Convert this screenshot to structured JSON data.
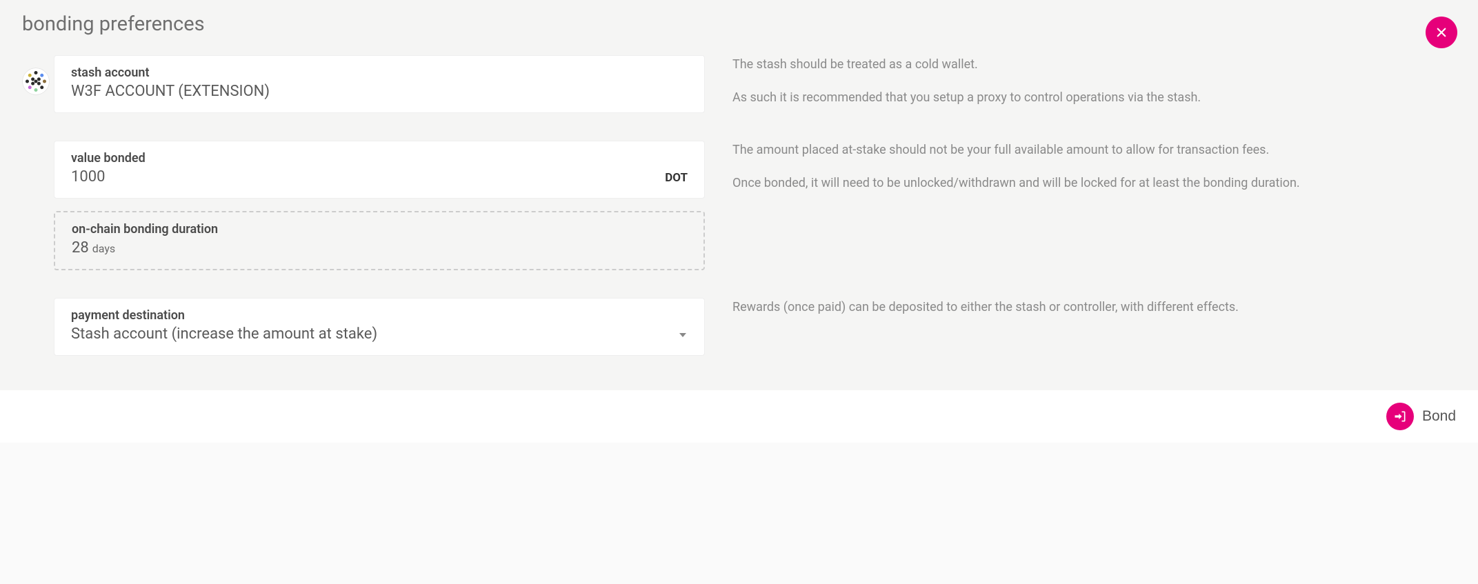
{
  "modal": {
    "title": "bonding preferences"
  },
  "stash": {
    "label": "stash account",
    "value": "W3F ACCOUNT (EXTENSION)",
    "help1": "The stash should be treated as a cold wallet.",
    "help2": "As such it is recommended that you setup a proxy to control operations via the stash."
  },
  "bonded": {
    "label": "value bonded",
    "value": "1000",
    "unit": "DOT",
    "duration_label": "on-chain bonding duration",
    "duration_value": "28",
    "duration_unit": "days",
    "help1": "The amount placed at-stake should not be your full available amount to allow for transaction fees.",
    "help2": "Once bonded, it will need to be unlocked/withdrawn and will be locked for at least the bonding duration."
  },
  "destination": {
    "label": "payment destination",
    "value": "Stash account (increase the amount at stake)",
    "help": "Rewards (once paid) can be deposited to either the stash or controller, with different effects."
  },
  "actions": {
    "bond": "Bond"
  }
}
